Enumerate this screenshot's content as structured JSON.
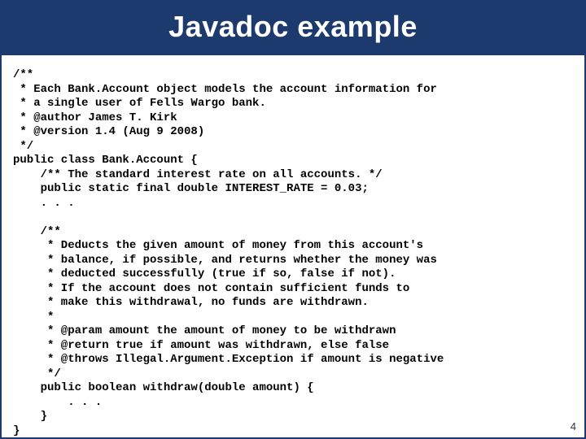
{
  "slide": {
    "title": "Javadoc example",
    "page_number": "4",
    "code": "/**\n * Each Bank.Account object models the account information for\n * a single user of Fells Wargo bank.\n * @author James T. Kirk\n * @version 1.4 (Aug 9 2008)\n */\npublic class Bank.Account {\n    /** The standard interest rate on all accounts. */\n    public static final double INTEREST_RATE = 0.03;\n    . . .\n\n    /**\n     * Deducts the given amount of money from this account's\n     * balance, if possible, and returns whether the money was\n     * deducted successfully (true if so, false if not).\n     * If the account does not contain sufficient funds to\n     * make this withdrawal, no funds are withdrawn.\n     *\n     * @param amount the amount of money to be withdrawn\n     * @return true if amount was withdrawn, else false\n     * @throws Illegal.Argument.Exception if amount is negative\n     */\n    public boolean withdraw(double amount) {\n        . . .\n    }\n}"
  }
}
